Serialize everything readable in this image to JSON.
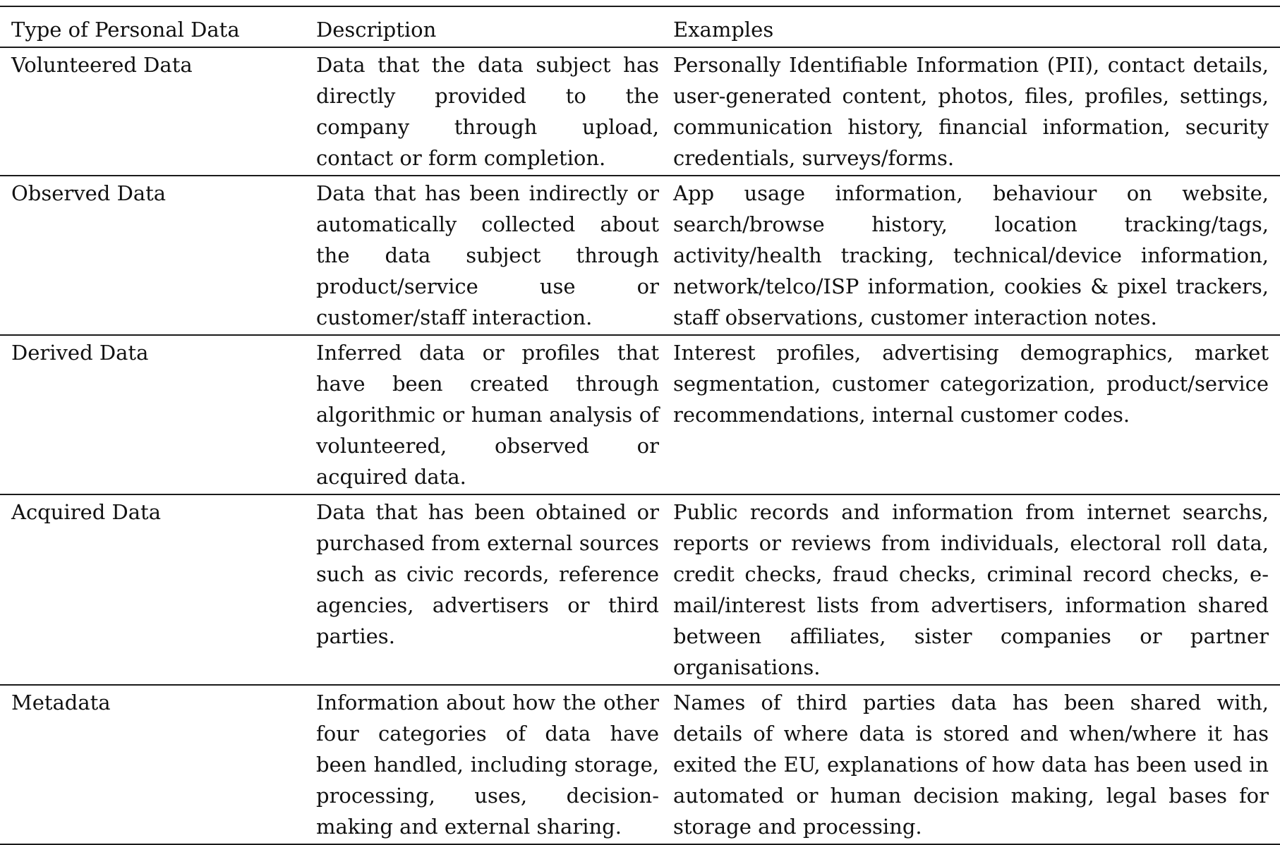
{
  "table": {
    "headers": {
      "type": "Type of Personal Data",
      "description": "Description",
      "examples": "Examples"
    },
    "rows": [
      {
        "type": "Volunteered Data",
        "description": "Data that the data subject has directly provided to the company through upload, contact or form completion.",
        "examples": "Personally Identifiable Information (PII), contact details, user-generated content, photos, files, profiles, settings, communication history, financial information, security credentials, surveys/forms."
      },
      {
        "type": "Observed Data",
        "description": "Data that has been indirectly or automatically collected about the data subject through product/service use or customer/staff interaction.",
        "examples": "App usage information, behaviour on website, search/browse history, location tracking/tags, activity/health tracking, technical/device information, network/telco/ISP information, cookies & pixel trackers, staff observations, customer interaction notes."
      },
      {
        "type": "Derived Data",
        "description": "Inferred data or profiles that have been created through algorithmic or human analysis of volunteered, observed or acquired data.",
        "examples": "Interest profiles, advertising demographics, market segmentation, customer categorization, product/service recommendations, internal customer codes."
      },
      {
        "type": "Acquired Data",
        "description": "Data that has been obtained or purchased from external sources such as civic records, reference agencies, advertisers or third parties.",
        "examples": "Public records and information from internet searchs, reports or reviews from individuals, electoral roll data, credit checks, fraud checks, criminal record checks, e-mail/interest lists from advertisers, information shared between affiliates, sister companies or partner organisations."
      },
      {
        "type": "Metadata",
        "description": "Information about how the other four categories of data have been handled, including storage, processing, uses, decision-making and external sharing.",
        "examples": "Names of third parties data has been shared with, details of where data is stored and when/where it has exited the EU, explanations of how data has been used in automated or human decision making, legal bases for storage and processing."
      }
    ]
  }
}
